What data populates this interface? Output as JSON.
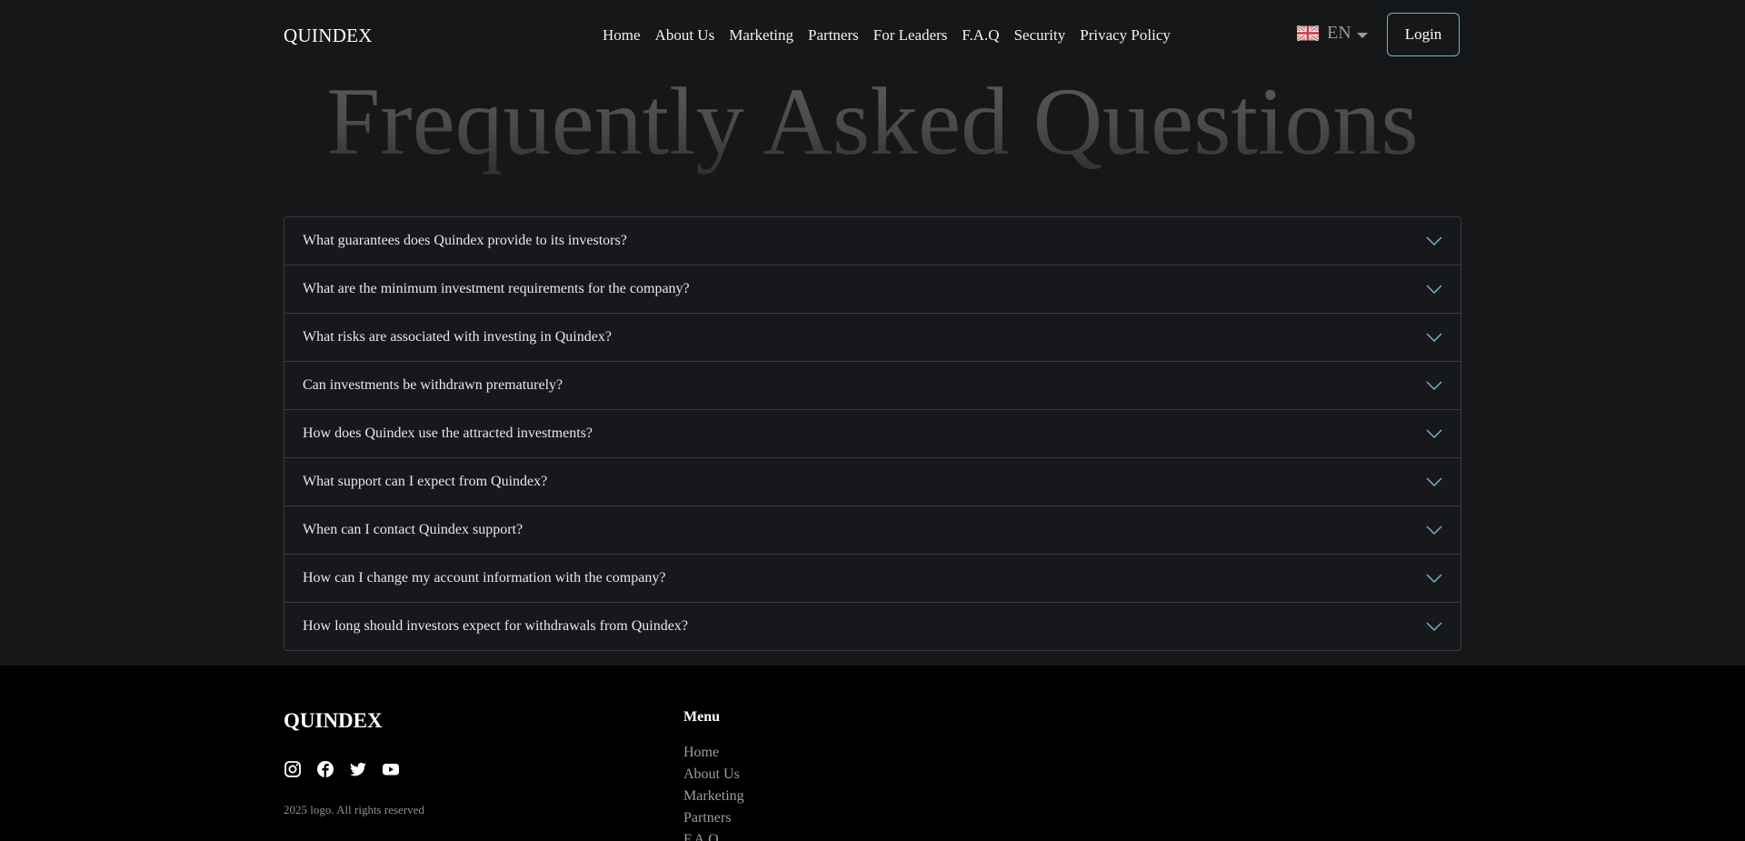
{
  "header": {
    "logo": "QUINDEX",
    "nav": [
      "Home",
      "About Us",
      "Marketing",
      "Partners",
      "For Leaders",
      "F.A.Q",
      "Security",
      "Privacy Policy"
    ],
    "language": "EN",
    "login_label": "Login"
  },
  "faq": {
    "title": "Frequently Asked Questions",
    "questions": [
      "What guarantees does Quindex provide to its investors?",
      "What are the minimum investment requirements for the company?",
      "What risks are associated with investing in Quindex?",
      "Can investments be withdrawn prematurely?",
      "How does Quindex use the attracted investments?",
      "What support can I expect from Quindex?",
      "When can I contact Quindex support?",
      "How can I change my account information with the company?",
      "How long should investors expect for withdrawals from Quindex?"
    ]
  },
  "footer": {
    "logo": "QUINDEX",
    "copyright": "2025 logo. All rights reserved",
    "menu_title": "Menu",
    "menu_items": [
      "Home",
      "About Us",
      "Marketing",
      "Partners",
      "F.A.Q"
    ],
    "socials": [
      "instagram-icon",
      "facebook-icon",
      "twitter-icon",
      "youtube-icon"
    ]
  },
  "colors": {
    "background": "#161719",
    "footer_background": "#000000",
    "accent": "#6fb3c8",
    "border": "#3a3b3e"
  }
}
